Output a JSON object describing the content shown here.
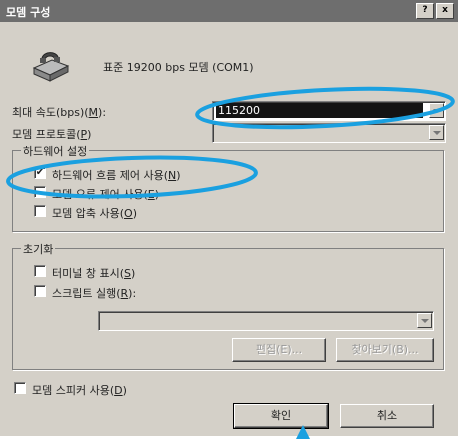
{
  "window": {
    "title": "모뎀 구성",
    "help_label": "?",
    "close_label": "x"
  },
  "modem": {
    "icon": "modem-icon",
    "name": "표준 19200 bps 모뎀 (COM1)"
  },
  "max_speed": {
    "label": "최대 속도(bps)(",
    "hotkey": "M",
    "suffix": "):",
    "value": "115200"
  },
  "protocol": {
    "label": "모뎀 프로토콜(",
    "hotkey": "P",
    "suffix": ")"
  },
  "hardware_settings": {
    "legend": "하드웨어 설정",
    "options": [
      {
        "label": "하드웨어 흐름 제어 사용(",
        "hotkey": "N",
        "suffix": ")",
        "checked": true,
        "mark": "✔"
      },
      {
        "label": "모뎀 오류 제어 사용(",
        "hotkey": "E",
        "suffix": ")",
        "checked": false,
        "mark": ""
      },
      {
        "label": "모뎀 압축 사용(",
        "hotkey": "O",
        "suffix": ")",
        "checked": false,
        "mark": ""
      }
    ]
  },
  "initialization": {
    "legend": "초기화",
    "options": [
      {
        "label": "터미널 창 표시(",
        "hotkey": "S",
        "suffix": ")",
        "checked": false,
        "mark": ""
      },
      {
        "label": "스크립트 실행(",
        "hotkey": "R",
        "suffix": "):",
        "checked": false,
        "mark": ""
      }
    ],
    "edit_button": "편집(E)...",
    "browse_button": "찾아보기(B)..."
  },
  "speaker": {
    "label": "모뎀 스피커 사용(",
    "hotkey": "D",
    "suffix": ")",
    "checked": false,
    "mark": ""
  },
  "buttons": {
    "ok": "확인",
    "cancel": "취소"
  },
  "colors": {
    "annotation": "#1aa0e0",
    "titlebar": "#6e6e6e",
    "dialog": "#d4d0c8"
  }
}
